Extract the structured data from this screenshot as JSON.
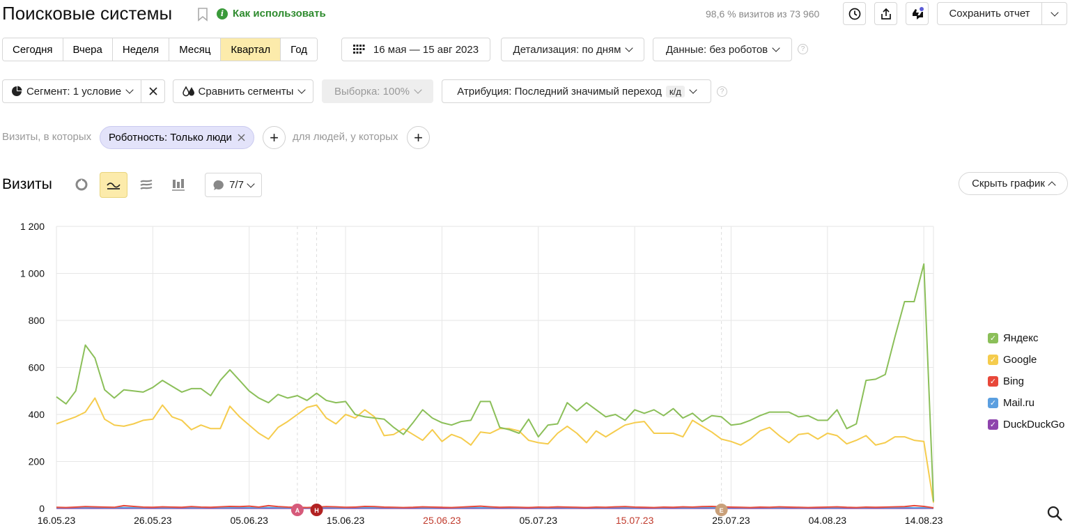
{
  "header": {
    "title": "Поисковые системы",
    "howto_label": "Как использовать",
    "stats": "98,6 % визитов из 73 960",
    "save_label": "Сохранить отчет"
  },
  "periods": [
    {
      "label": "Сегодня",
      "active": false
    },
    {
      "label": "Вчера",
      "active": false
    },
    {
      "label": "Неделя",
      "active": false
    },
    {
      "label": "Месяц",
      "active": false
    },
    {
      "label": "Квартал",
      "active": true
    },
    {
      "label": "Год",
      "active": false
    }
  ],
  "toolbar": {
    "date_range": "16 мая — 15 авг 2023",
    "detail": "Детализация: по дням",
    "data": "Данные: без роботов",
    "segment": "Сегмент: 1 условие",
    "compare": "Сравнить сегменты",
    "sample": "Выборка: 100%",
    "attribution": "Атрибуция: Последний значимый переход",
    "attribution_badge": "к/д"
  },
  "filters": {
    "visits_prefix": "Визиты, в которых",
    "chip": "Роботность: Только люди",
    "people_prefix": "для людей, у которых"
  },
  "chart_header": {
    "title": "Визиты",
    "annotations": "7/7",
    "hide_label": "Скрыть график"
  },
  "colors": {
    "accent": "#fcebab",
    "yandex": "#8bbf59",
    "google": "#f5cc4d",
    "bing": "#e8483a",
    "mailru": "#5b9fe0",
    "duckduckgo": "#8e44ad",
    "holiday": "#c0392b"
  },
  "legend": [
    {
      "name": "Яндекс",
      "color": "#8bbf59"
    },
    {
      "name": "Google",
      "color": "#f5cc4d"
    },
    {
      "name": "Bing",
      "color": "#e8483a"
    },
    {
      "name": "Mail.ru",
      "color": "#5b9fe0"
    },
    {
      "name": "DuckDuckGo",
      "color": "#8e44ad"
    }
  ],
  "chart_data": {
    "type": "line",
    "x_start": "16.05.23",
    "x_end": "15.08.23",
    "x_tick_labels": [
      "16.05.23",
      "26.05.23",
      "05.06.23",
      "15.06.23",
      "25.06.23",
      "05.07.23",
      "15.07.23",
      "25.07.23",
      "04.08.23",
      "14.08.23"
    ],
    "x_tick_holiday": [
      false,
      false,
      false,
      false,
      true,
      false,
      true,
      false,
      false,
      false
    ],
    "ylim": [
      0,
      1200
    ],
    "y_ticks": [
      0,
      200,
      400,
      600,
      800,
      1000,
      1200
    ],
    "y_tick_labels": [
      "0",
      "200",
      "400",
      "600",
      "800",
      "1 000",
      "1 200"
    ],
    "markers": [
      {
        "label": "А",
        "day": 25,
        "color": "#d65a7a"
      },
      {
        "label": "Н",
        "day": 27,
        "color": "#b22222"
      },
      {
        "label": "Е",
        "day": 69,
        "color": "#c9a07a"
      }
    ],
    "series": [
      {
        "name": "Яндекс",
        "values": [
          475,
          445,
          500,
          695,
          640,
          505,
          470,
          505,
          500,
          495,
          515,
          545,
          520,
          495,
          510,
          510,
          480,
          545,
          590,
          545,
          500,
          470,
          450,
          485,
          470,
          480,
          460,
          490,
          460,
          450,
          455,
          400,
          390,
          385,
          380,
          345,
          315,
          365,
          420,
          385,
          365,
          355,
          370,
          375,
          455,
          455,
          345,
          335,
          320,
          380,
          305,
          355,
          360,
          450,
          415,
          450,
          420,
          390,
          400,
          375,
          420,
          405,
          420,
          395,
          425,
          385,
          405,
          370,
          395,
          390,
          355,
          360,
          375,
          395,
          410,
          410,
          410,
          390,
          395,
          375,
          375,
          420,
          340,
          360,
          545,
          550,
          570,
          730,
          880,
          880,
          1040,
          30
        ]
      },
      {
        "name": "Google",
        "values": [
          360,
          375,
          390,
          410,
          470,
          380,
          355,
          350,
          360,
          375,
          380,
          440,
          390,
          375,
          335,
          355,
          340,
          340,
          435,
          390,
          355,
          320,
          295,
          345,
          370,
          400,
          430,
          440,
          385,
          360,
          400,
          385,
          420,
          390,
          310,
          315,
          340,
          315,
          290,
          335,
          285,
          315,
          300,
          270,
          325,
          320,
          340,
          340,
          330,
          290,
          280,
          275,
          320,
          350,
          320,
          280,
          330,
          305,
          330,
          355,
          365,
          370,
          320,
          320,
          320,
          305,
          375,
          350,
          325,
          295,
          285,
          270,
          295,
          330,
          345,
          310,
          280,
          315,
          320,
          295,
          320,
          310,
          275,
          290,
          310,
          270,
          280,
          305,
          305,
          290,
          285,
          25
        ]
      },
      {
        "name": "Bing",
        "values": [
          5,
          4,
          6,
          8,
          7,
          6,
          5,
          12,
          9,
          6,
          5,
          7,
          6,
          5,
          8,
          6,
          5,
          7,
          9,
          8,
          10,
          6,
          12,
          8,
          6,
          5,
          4,
          6,
          8,
          7,
          5,
          6,
          9,
          8,
          6,
          5,
          4,
          5,
          7,
          6,
          5,
          4,
          6,
          8,
          10,
          7,
          5,
          6,
          5,
          4,
          6,
          5,
          7,
          6,
          5,
          4,
          6,
          5,
          7,
          8,
          6,
          5,
          4,
          6,
          5,
          7,
          6,
          8,
          9,
          7,
          6,
          5,
          4,
          6,
          5,
          7,
          6,
          5,
          4,
          5,
          6,
          7,
          5,
          4,
          6,
          5,
          6,
          7,
          8,
          12,
          9,
          3
        ]
      },
      {
        "name": "Mail.ru",
        "values": [
          3,
          3,
          4,
          3,
          4,
          3,
          3,
          4,
          3,
          3,
          4,
          3,
          3,
          4,
          3,
          3,
          4,
          3,
          3,
          4,
          3,
          3,
          4,
          3,
          3,
          4,
          3,
          3,
          4,
          3,
          3,
          4,
          3,
          3,
          4,
          3,
          3,
          4,
          3,
          3,
          4,
          3,
          3,
          4,
          3,
          3,
          4,
          3,
          3,
          4,
          3,
          3,
          4,
          3,
          3,
          4,
          3,
          3,
          4,
          3,
          3,
          4,
          3,
          3,
          4,
          3,
          3,
          4,
          3,
          3,
          4,
          3,
          3,
          4,
          3,
          3,
          4,
          3,
          3,
          4,
          3,
          3,
          4,
          3,
          3,
          4,
          3,
          3,
          4,
          3,
          3,
          2
        ]
      },
      {
        "name": "DuckDuckGo",
        "values": [
          1,
          1,
          1,
          1,
          1,
          1,
          1,
          1,
          1,
          1,
          1,
          1,
          1,
          1,
          1,
          1,
          1,
          1,
          1,
          1,
          1,
          1,
          1,
          1,
          1,
          1,
          1,
          1,
          1,
          1,
          1,
          1,
          1,
          1,
          1,
          1,
          1,
          1,
          1,
          1,
          1,
          1,
          1,
          1,
          1,
          1,
          1,
          1,
          1,
          1,
          1,
          1,
          1,
          1,
          1,
          1,
          1,
          1,
          1,
          1,
          1,
          1,
          1,
          1,
          1,
          1,
          1,
          1,
          1,
          1,
          1,
          1,
          1,
          1,
          1,
          1,
          1,
          1,
          1,
          1,
          1,
          1,
          1,
          1,
          1,
          1,
          1,
          1,
          1,
          1,
          1,
          1
        ]
      }
    ]
  }
}
